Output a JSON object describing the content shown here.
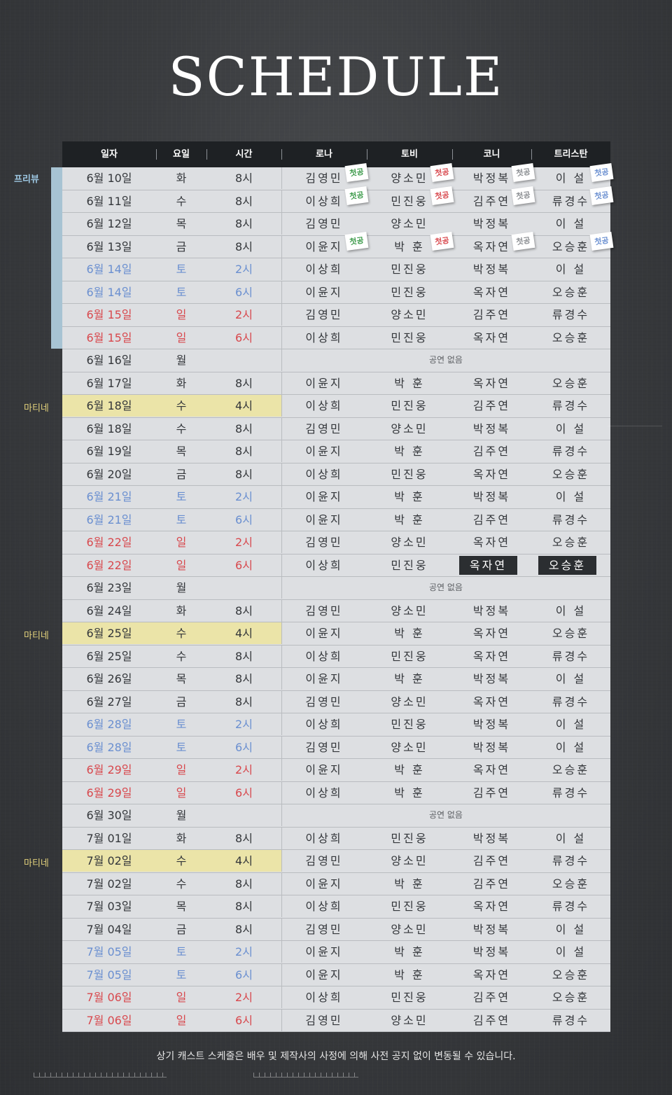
{
  "page_title": "SCHEDULE",
  "columns": [
    "일자",
    "요일",
    "시간",
    "로나",
    "토비",
    "코니",
    "트리스탄"
  ],
  "side_labels": {
    "preview": "프리뷰",
    "matinee": "마티네"
  },
  "badge_text": "첫공",
  "colors": {
    "saturday": "#6a8fd0",
    "sunday": "#d8484d",
    "matinee_bg": "#ebe4a8",
    "preview_bar": "#a7c3d3",
    "highlight_bg": "#2b2e31"
  },
  "footer_note": "상기 캐스트 스케줄은 배우 및 제작사의 사정에 의해 사전 공지 없이 변동될 수 있습니다.",
  "rows": [
    {
      "date": "6월 10일",
      "day": "화",
      "time": "8시",
      "cast": [
        "김영민",
        "양소민",
        "박정복",
        "이 설"
      ],
      "badges": [
        "green",
        "red",
        "gray",
        "blue"
      ]
    },
    {
      "date": "6월 11일",
      "day": "수",
      "time": "8시",
      "cast": [
        "이상희",
        "민진웅",
        "김주연",
        "류경수"
      ],
      "badges": [
        "green",
        "red",
        "gray",
        "blue"
      ]
    },
    {
      "date": "6월 12일",
      "day": "목",
      "time": "8시",
      "cast": [
        "김영민",
        "양소민",
        "박정복",
        "이 설"
      ]
    },
    {
      "date": "6월 13일",
      "day": "금",
      "time": "8시",
      "cast": [
        "이윤지",
        "박 훈",
        "옥자연",
        "오승훈"
      ],
      "badges": [
        "green",
        "red",
        "gray",
        "blue"
      ]
    },
    {
      "date": "6월 14일",
      "day": "토",
      "time": "2시",
      "cast": [
        "이상희",
        "민진웅",
        "박정복",
        "이 설"
      ],
      "color": "blue"
    },
    {
      "date": "6월 14일",
      "day": "토",
      "time": "6시",
      "cast": [
        "이윤지",
        "민진웅",
        "옥자연",
        "오승훈"
      ],
      "color": "blue"
    },
    {
      "date": "6월 15일",
      "day": "일",
      "time": "2시",
      "cast": [
        "김영민",
        "양소민",
        "김주연",
        "류경수"
      ],
      "color": "red"
    },
    {
      "date": "6월 15일",
      "day": "일",
      "time": "6시",
      "cast": [
        "이상희",
        "민진웅",
        "옥자연",
        "오승훈"
      ],
      "color": "red"
    },
    {
      "date": "6월 16일",
      "day": "월",
      "time": "",
      "note": "공연 없음"
    },
    {
      "date": "6월 17일",
      "day": "화",
      "time": "8시",
      "cast": [
        "이윤지",
        "박 훈",
        "옥자연",
        "오승훈"
      ]
    },
    {
      "date": "6월 18일",
      "day": "수",
      "time": "4시",
      "cast": [
        "이상희",
        "민진웅",
        "김주연",
        "류경수"
      ],
      "matinee": true
    },
    {
      "date": "6월 18일",
      "day": "수",
      "time": "8시",
      "cast": [
        "김영민",
        "양소민",
        "박정복",
        "이 설"
      ]
    },
    {
      "date": "6월 19일",
      "day": "목",
      "time": "8시",
      "cast": [
        "이윤지",
        "박 훈",
        "김주연",
        "류경수"
      ]
    },
    {
      "date": "6월 20일",
      "day": "금",
      "time": "8시",
      "cast": [
        "이상희",
        "민진웅",
        "옥자연",
        "오승훈"
      ]
    },
    {
      "date": "6월 21일",
      "day": "토",
      "time": "2시",
      "cast": [
        "이윤지",
        "박 훈",
        "박정복",
        "이 설"
      ],
      "color": "blue"
    },
    {
      "date": "6월 21일",
      "day": "토",
      "time": "6시",
      "cast": [
        "이윤지",
        "박 훈",
        "김주연",
        "류경수"
      ],
      "color": "blue"
    },
    {
      "date": "6월 22일",
      "day": "일",
      "time": "2시",
      "cast": [
        "김영민",
        "양소민",
        "옥자연",
        "오승훈"
      ],
      "color": "red"
    },
    {
      "date": "6월 22일",
      "day": "일",
      "time": "6시",
      "cast": [
        "이상희",
        "민진웅",
        "옥자연",
        "오승훈"
      ],
      "color": "red",
      "highlight": [
        2,
        3
      ]
    },
    {
      "date": "6월 23일",
      "day": "월",
      "time": "",
      "note": "공연 없음"
    },
    {
      "date": "6월 24일",
      "day": "화",
      "time": "8시",
      "cast": [
        "김영민",
        "양소민",
        "박정복",
        "이 설"
      ]
    },
    {
      "date": "6월 25일",
      "day": "수",
      "time": "4시",
      "cast": [
        "이윤지",
        "박 훈",
        "옥자연",
        "오승훈"
      ],
      "matinee": true
    },
    {
      "date": "6월 25일",
      "day": "수",
      "time": "8시",
      "cast": [
        "이상희",
        "민진웅",
        "옥자연",
        "류경수"
      ]
    },
    {
      "date": "6월 26일",
      "day": "목",
      "time": "8시",
      "cast": [
        "이윤지",
        "박 훈",
        "박정복",
        "이 설"
      ]
    },
    {
      "date": "6월 27일",
      "day": "금",
      "time": "8시",
      "cast": [
        "김영민",
        "양소민",
        "옥자연",
        "류경수"
      ]
    },
    {
      "date": "6월 28일",
      "day": "토",
      "time": "2시",
      "cast": [
        "이상희",
        "민진웅",
        "박정복",
        "이 설"
      ],
      "color": "blue"
    },
    {
      "date": "6월 28일",
      "day": "토",
      "time": "6시",
      "cast": [
        "김영민",
        "양소민",
        "박정복",
        "이 설"
      ],
      "color": "blue"
    },
    {
      "date": "6월 29일",
      "day": "일",
      "time": "2시",
      "cast": [
        "이윤지",
        "박 훈",
        "옥자연",
        "오승훈"
      ],
      "color": "red"
    },
    {
      "date": "6월 29일",
      "day": "일",
      "time": "6시",
      "cast": [
        "이상희",
        "박 훈",
        "김주연",
        "류경수"
      ],
      "color": "red"
    },
    {
      "date": "6월 30일",
      "day": "월",
      "time": "",
      "note": "공연 없음"
    },
    {
      "date": "7월 01일",
      "day": "화",
      "time": "8시",
      "cast": [
        "이상희",
        "민진웅",
        "박정복",
        "이 설"
      ]
    },
    {
      "date": "7월 02일",
      "day": "수",
      "time": "4시",
      "cast": [
        "김영민",
        "양소민",
        "김주연",
        "류경수"
      ],
      "matinee": true
    },
    {
      "date": "7월 02일",
      "day": "수",
      "time": "8시",
      "cast": [
        "이윤지",
        "박 훈",
        "김주연",
        "오승훈"
      ]
    },
    {
      "date": "7월 03일",
      "day": "목",
      "time": "8시",
      "cast": [
        "이상희",
        "민진웅",
        "옥자연",
        "류경수"
      ]
    },
    {
      "date": "7월 04일",
      "day": "금",
      "time": "8시",
      "cast": [
        "김영민",
        "양소민",
        "박정복",
        "이 설"
      ]
    },
    {
      "date": "7월 05일",
      "day": "토",
      "time": "2시",
      "cast": [
        "이윤지",
        "박 훈",
        "박정복",
        "이 설"
      ],
      "color": "blue"
    },
    {
      "date": "7월 05일",
      "day": "토",
      "time": "6시",
      "cast": [
        "이윤지",
        "박 훈",
        "옥자연",
        "오승훈"
      ],
      "color": "blue"
    },
    {
      "date": "7월 06일",
      "day": "일",
      "time": "2시",
      "cast": [
        "이상희",
        "민진웅",
        "김주연",
        "오승훈"
      ],
      "color": "red"
    },
    {
      "date": "7월 06일",
      "day": "일",
      "time": "6시",
      "cast": [
        "김영민",
        "양소민",
        "김주연",
        "류경수"
      ],
      "color": "red"
    }
  ]
}
